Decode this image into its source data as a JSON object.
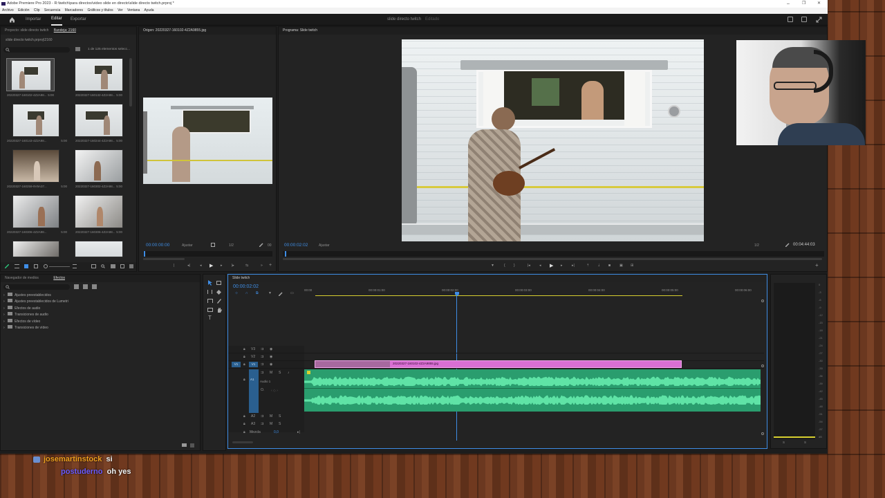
{
  "window": {
    "title": "Adobe Premiere Pro 2023 - R:\\twitch\\para directos\\video slide en directo\\slide directo twitch.prproj *",
    "controls": [
      "–",
      "❐",
      "✕"
    ]
  },
  "menu": [
    "Archivo",
    "Edición",
    "Clip",
    "Secuencia",
    "Marcadores",
    "Gráficos y títulos",
    "Ver",
    "Ventana",
    "Ayuda"
  ],
  "header": {
    "tabs": [
      "Importar",
      "Editar",
      "Exportar"
    ],
    "active_tab": "Editar",
    "project_name": "slide directo twitch",
    "status": "Editado"
  },
  "project_panel": {
    "tabs": [
      "Proyecto: slide directo twitch",
      "Bandeja: 2160"
    ],
    "path": "slide directo twitch.prproj\\2160",
    "count": "1 de 125 elementos selecc...",
    "items": [
      {
        "name": "20220327-160102-4Z2A98...",
        "duration": "5:00"
      },
      {
        "name": "20220327-160132-4Z2A98...",
        "duration": "5:00"
      },
      {
        "name": "20220327-160143-4Z2A98...",
        "duration": "5:00"
      },
      {
        "name": "20220327-160244-4Z2A98...",
        "duration": "5:00"
      },
      {
        "name": "20220327-160259-9V9A37...",
        "duration": "5:00"
      },
      {
        "name": "20220327-160302-4Z2A98...",
        "duration": "5:00"
      },
      {
        "name": "20220327-160306-4Z2A98...",
        "duration": "5:00"
      },
      {
        "name": "20220327-160306-4Z2A98...",
        "duration": "5:00"
      }
    ]
  },
  "source_monitor": {
    "title": "Origen: 20220327-160102-4Z2A9855.jpg",
    "timecode": "00:00:00:00",
    "fit": "Ajustar",
    "quality": "1/2",
    "end": "00"
  },
  "program_monitor": {
    "title": "Programa: Slide twitch",
    "timecode": "00:00:02:02",
    "fit": "Ajustar",
    "quality": "1/2",
    "duration": "00:04:44:03"
  },
  "effects_panel": {
    "tabs": [
      "Navegador de medios",
      "Efectos"
    ],
    "items": [
      "Ajustes preestablecidos",
      "Ajustes preestablecidos de Lumetri",
      "Efectos de audio",
      "Transiciones de audio",
      "Efectos de vídeo",
      "Transiciones de vídeo"
    ]
  },
  "timeline": {
    "tab": "Slide twitch",
    "timecode": "00:00:02:02",
    "ruler": [
      "00:00",
      "00:00:01:00",
      "00:00:02:00",
      "00:00:03:00",
      "00:00:04:00",
      "00:00:05:00",
      "00:00:06:00"
    ],
    "tracks": [
      "V3",
      "V2",
      "V1",
      "A1",
      "A2",
      "A3"
    ],
    "video_clip": "20220327-160102-4Z2A9855.jpg",
    "audio_label": "Audio 1",
    "mix_label": "Mezcla",
    "mix_value": "0,0"
  },
  "meters": {
    "ticks": [
      "0",
      "-3",
      "-6",
      "-9",
      "-12",
      "-15",
      "-18",
      "-21",
      "-24",
      "-27",
      "-30",
      "-33",
      "-36",
      "-39",
      "-42",
      "-45",
      "-48",
      "-51",
      "-54",
      "-57",
      "dB"
    ],
    "bottom": [
      "S",
      "S"
    ]
  },
  "chat": [
    {
      "user": "josemartinstock",
      "message": "si",
      "color": "#f0a020"
    },
    {
      "user": "postuderno",
      "message": "oh yes",
      "color": "#6c5cff"
    }
  ],
  "colors": {
    "accent_blue": "#3f8ee6",
    "video_clip": "#d96fd3",
    "audio_clip": "#2a9d6e",
    "workarea": "#d8d030"
  }
}
